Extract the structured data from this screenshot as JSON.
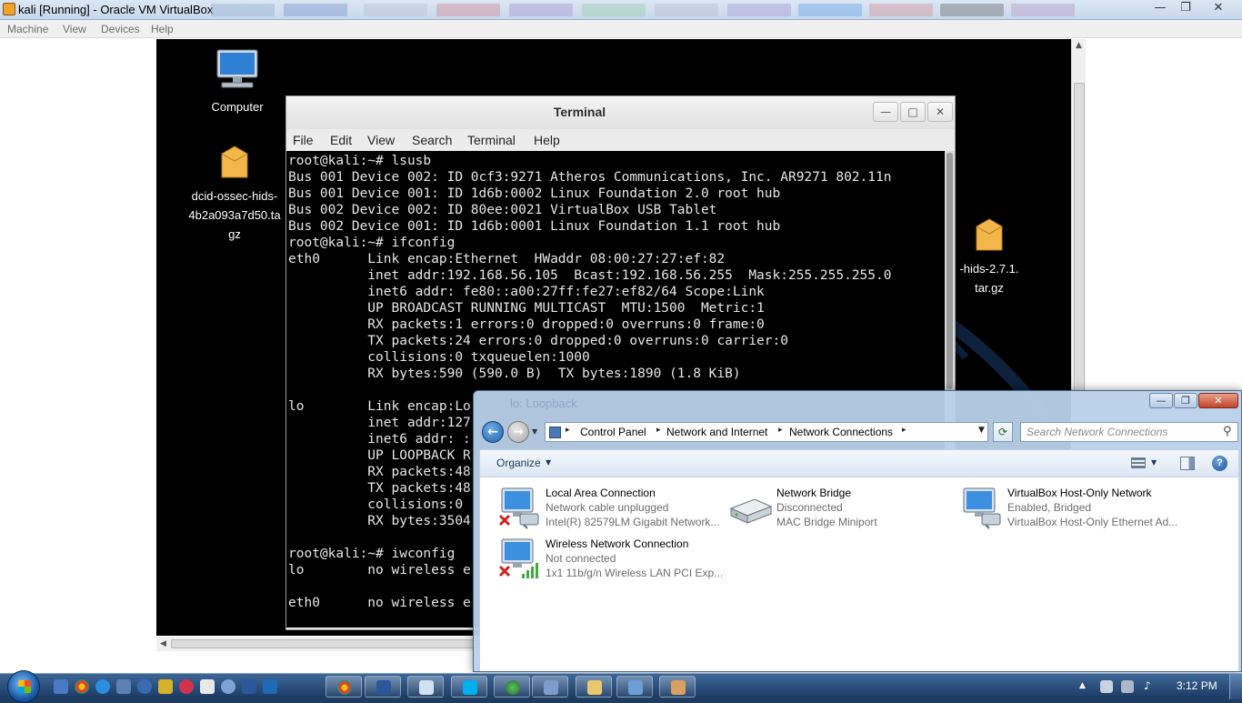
{
  "vbox": {
    "title": "kali [Running] - Oracle VM VirtualBox",
    "menu": [
      "Machine",
      "View",
      "Devices",
      "Help"
    ],
    "minimize": "—",
    "restore": "❐",
    "close": "✕"
  },
  "desktop": {
    "computer_label": "Computer",
    "archive1_label_lines": [
      "dcid-ossec-hids-",
      "4b2a093a7d50.ta",
      "gz"
    ],
    "archive2_label_lines": [
      "-hids-2.7.1.",
      "tar.gz"
    ]
  },
  "terminal": {
    "title": "Terminal",
    "minimize": "—",
    "maximize": "□",
    "close": "✕",
    "menu": [
      "File",
      "Edit",
      "View",
      "Search",
      "Terminal",
      "Help"
    ],
    "lines": [
      "root@kali:~# lsusb",
      "Bus 001 Device 002: ID 0cf3:9271 Atheros Communications, Inc. AR9271 802.11n",
      "Bus 001 Device 001: ID 1d6b:0002 Linux Foundation 2.0 root hub",
      "Bus 002 Device 002: ID 80ee:0021 VirtualBox USB Tablet",
      "Bus 002 Device 001: ID 1d6b:0001 Linux Foundation 1.1 root hub",
      "root@kali:~# ifconfig",
      "eth0      Link encap:Ethernet  HWaddr 08:00:27:27:ef:82",
      "          inet addr:192.168.56.105  Bcast:192.168.56.255  Mask:255.255.255.0",
      "          inet6 addr: fe80::a00:27ff:fe27:ef82/64 Scope:Link",
      "          UP BROADCAST RUNNING MULTICAST  MTU:1500  Metric:1",
      "          RX packets:1 errors:0 dropped:0 overruns:0 frame:0",
      "          TX packets:24 errors:0 dropped:0 overruns:0 carrier:0",
      "          collisions:0 txqueuelen:1000",
      "          RX bytes:590 (590.0 B)  TX bytes:1890 (1.8 KiB)",
      "",
      "lo        Link encap:Lo",
      "          inet addr:127",
      "          inet6 addr: :",
      "          UP LOOPBACK R",
      "          RX packets:48",
      "          TX packets:48",
      "          collisions:0",
      "          RX bytes:3504",
      "",
      "root@kali:~# iwconfig",
      "lo        no wireless e",
      "",
      "eth0      no wireless e"
    ]
  },
  "netwin": {
    "ghost_title": "lo: Loopback",
    "minimize": "—",
    "restore": "❐",
    "close": "✕",
    "back": "←",
    "forward": "→",
    "history": "▼",
    "breadcrumb": [
      "Control Panel",
      "Network and Internet",
      "Network Connections"
    ],
    "crumb_sep": "▸",
    "dropdown": "▼",
    "refresh": "⟳",
    "search_placeholder": "Search Network Connections",
    "search_glyph": "⚲",
    "organize": "Organize",
    "organize_arrow": "▼",
    "view_arrow": "▼",
    "help": "?",
    "connections": [
      {
        "name": "Local Area Connection",
        "status": "Network cable unplugged",
        "device": "Intel(R) 82579LM Gigabit Network..."
      },
      {
        "name": "Network Bridge",
        "status": "Disconnected",
        "device": "MAC Bridge Miniport"
      },
      {
        "name": "VirtualBox Host-Only Network",
        "status": "Enabled, Bridged",
        "device": "VirtualBox Host-Only Ethernet Ad..."
      },
      {
        "name": "Wireless Network Connection",
        "status": "Not connected",
        "device": "1x1 11b/g/n Wireless LAN PCI Exp..."
      }
    ]
  },
  "taskbar": {
    "clock": "3:12 PM",
    "tray_up": "▲",
    "volume": "♪"
  },
  "colors": {
    "taskbar": "#2a4f7e",
    "accent": "#1f5fa8",
    "error_x": "#d21f1f"
  }
}
